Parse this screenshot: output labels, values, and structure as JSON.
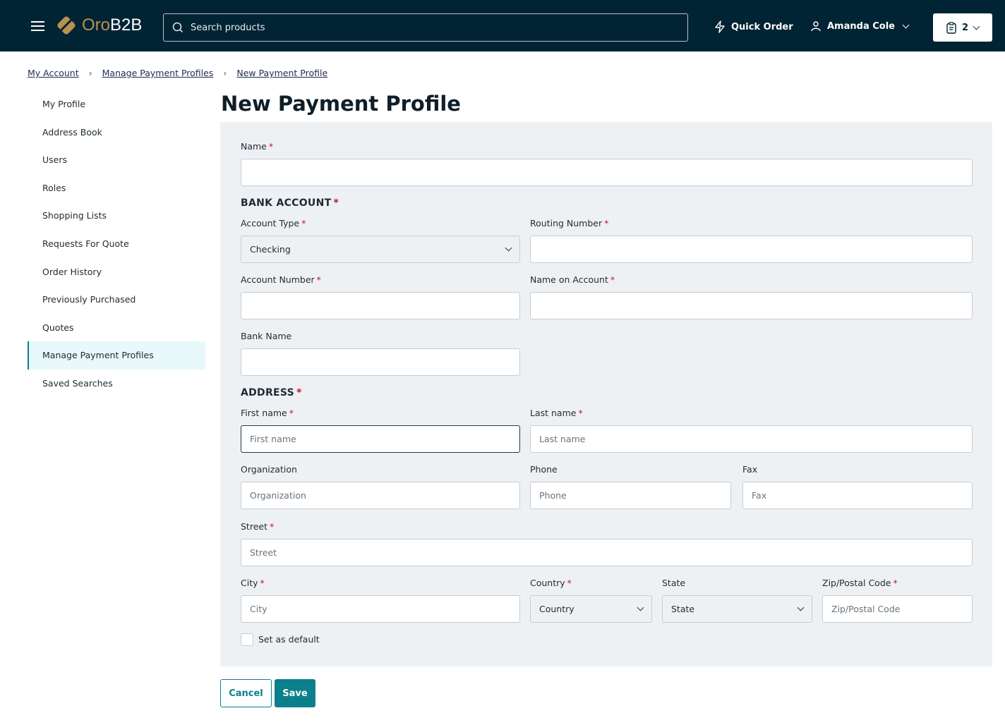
{
  "header": {
    "logo_oro": "Oro",
    "logo_b2b": "B2B",
    "search_placeholder": "Search products",
    "quick_order": "Quick Order",
    "user_name": "Amanda Cole",
    "cart_count": "2"
  },
  "breadcrumb": [
    "My Account",
    "Manage Payment Profiles",
    "New Payment Profile"
  ],
  "sidebar": {
    "items": [
      "My Profile",
      "Address Book",
      "Users",
      "Roles",
      "Shopping Lists",
      "Requests For Quote",
      "Order History",
      "Previously Purchased",
      "Quotes",
      "Manage Payment Profiles",
      "Saved Searches"
    ],
    "active": "Manage Payment Profiles"
  },
  "page": {
    "title": "New Payment Profile"
  },
  "form": {
    "name_label": "Name",
    "bank_section": "BANK ACCOUNT",
    "address_section": "ADDRESS",
    "required_mark": "*",
    "account_type_label": "Account Type",
    "account_type_value": "Checking",
    "routing_label": "Routing Number",
    "account_number_label": "Account Number",
    "name_on_account_label": "Name on Account",
    "bank_name_label": "Bank Name",
    "first_name_label": "First name",
    "first_name_placeholder": "First name",
    "last_name_label": "Last name",
    "last_name_placeholder": "Last name",
    "organization_label": "Organization",
    "organization_placeholder": "Organization",
    "phone_label": "Phone",
    "phone_placeholder": "Phone",
    "fax_label": "Fax",
    "fax_placeholder": "Fax",
    "street_label": "Street",
    "street_placeholder": "Street",
    "city_label": "City",
    "city_placeholder": "City",
    "country_label": "Country",
    "country_value": "Country",
    "state_label": "State",
    "state_value": "State",
    "zip_label": "Zip/Postal Code",
    "zip_placeholder": "Zip/Postal Code",
    "default_label": "Set as default"
  },
  "actions": {
    "cancel": "Cancel",
    "save": "Save"
  },
  "colors": {
    "header": "#002434",
    "accent": "#0c7f8c",
    "brand": "#b8914f",
    "required": "#c8102e"
  }
}
